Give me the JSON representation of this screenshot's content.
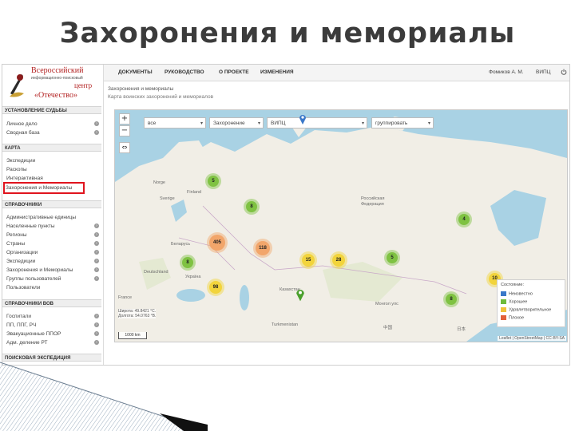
{
  "slide_title": "Захоронения и мемориалы",
  "logo": {
    "line1": "Всероссийский",
    "line2": "информационно-поисковый",
    "line3": "центр",
    "line4": "«Отечество»"
  },
  "sidebar": {
    "sections": [
      {
        "title": "УСТАНОВЛЕНИЕ СУДЬБЫ",
        "items": [
          "Личное дело",
          "Сводная база"
        ]
      },
      {
        "title": "КАРТА",
        "items": [
          "Экспедиции",
          "Раскопы",
          "Интерактивная",
          "Захоронения и Мемориалы"
        ]
      },
      {
        "title": "СПРАВОЧНИКИ",
        "items": [
          "Административные единицы",
          "Населенные пункты",
          "Регионы",
          "Страны",
          "Организации",
          "Экспедиции",
          "Захоронения и Мемориалы",
          "Группы пользователей",
          "Пользователи"
        ]
      },
      {
        "title": "СПРАВОЧНИКИ ВОВ",
        "items": [
          "Госпитали",
          "ПП, ППГ, РЧ",
          "Эвакуационные ППОР",
          "Адм. деление РТ"
        ]
      },
      {
        "title": "ПОИСКОВАЯ ЭКСПЕДИЦИЯ",
        "items": []
      }
    ]
  },
  "topbar": {
    "menu": [
      "ДОКУМЕНТЫ",
      "РУКОВОДСТВО",
      "О ПРОЕКТЕ",
      "ИЗМЕНЕНИЯ"
    ],
    "user_name": "Фомиков А. М.",
    "user_org": "ВИПЦ"
  },
  "breadcrumb": "Захоронения и мемориалы",
  "subcrumb": "Карта воинских захоронений и мемориалов",
  "filters": [
    {
      "value": "все"
    },
    {
      "value": "Захоронение"
    },
    {
      "value": "ВИПЦ"
    },
    {
      "value": "группировать"
    }
  ],
  "map_controls": {
    "zoom_in": "+",
    "zoom_out": "−",
    "fullscreen": "⇔"
  },
  "clusters": [
    {
      "label": "5",
      "color": "green"
    },
    {
      "label": "8",
      "color": "green"
    },
    {
      "label": "4",
      "color": "green"
    },
    {
      "label": "405",
      "color": "orange"
    },
    {
      "label": "118",
      "color": "orange"
    },
    {
      "label": "15",
      "color": "yellow"
    },
    {
      "label": "28",
      "color": "yellow"
    },
    {
      "label": "5",
      "color": "green"
    },
    {
      "label": "8",
      "color": "green"
    },
    {
      "label": "98",
      "color": "yellow"
    },
    {
      "label": "10",
      "color": "yellow"
    },
    {
      "label": "8",
      "color": "green"
    }
  ],
  "map_labels": [
    "Россия",
    "Finland",
    "Sverige",
    "Norge",
    "Беларусь",
    "Deutschland",
    "Україна",
    "France",
    "Российская Федерация",
    "Казахстан",
    "Монгол улс",
    "Turkmenistan",
    "中国",
    "日本"
  ],
  "legend": {
    "title": "Состояние:",
    "items": [
      {
        "label": "Неизвестно",
        "color": "#3a78c9"
      },
      {
        "label": "Хорошее",
        "color": "#6fbb3b"
      },
      {
        "label": "Удовлетворительное",
        "color": "#f0c23a"
      },
      {
        "label": "Плохое",
        "color": "#e2603a"
      }
    ]
  },
  "coords": {
    "l1": "Широта: 49.8421 °C.",
    "l2": "Долгота: 54.0763 °В."
  },
  "scale": "1000 km",
  "attribution": "Leaflet | OpenStreetMap | CC-BY-SA"
}
